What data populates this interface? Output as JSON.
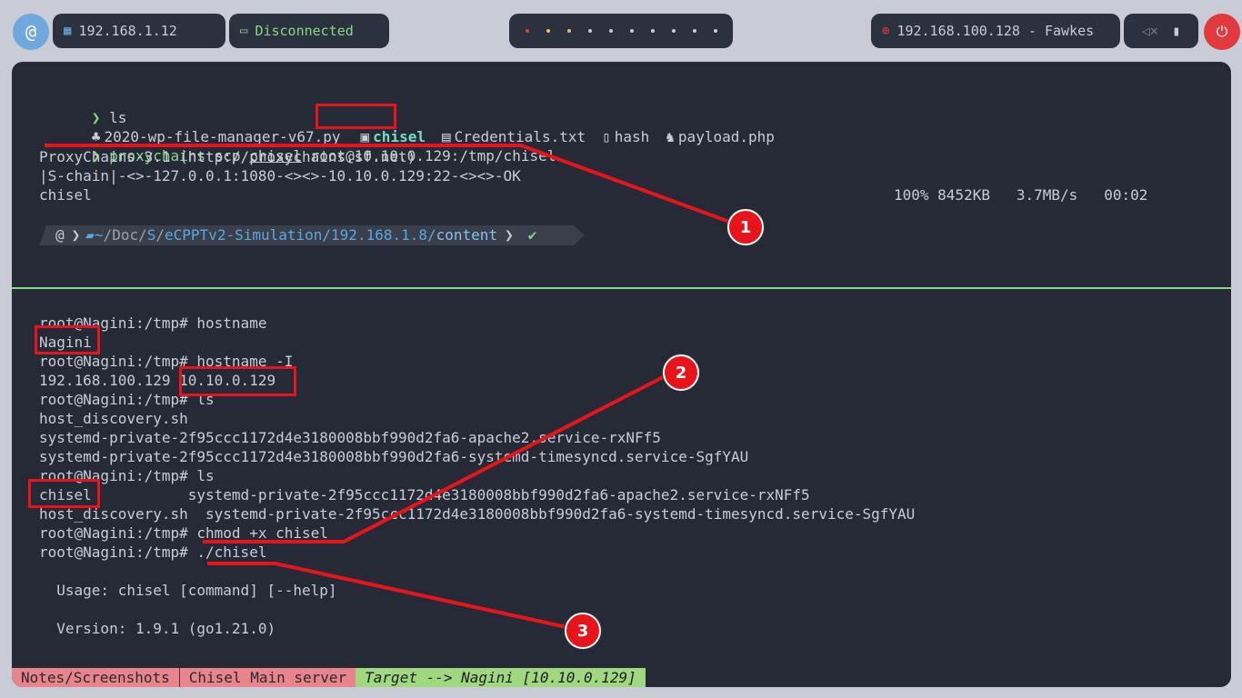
{
  "topbar": {
    "ip_local": "192.168.1.12",
    "vpn_status": "Disconnected",
    "target": "192.168.100.128 - Fawkes"
  },
  "terminal_top": {
    "line1_cmd": "ls",
    "files": [
      "2020-wp-file-manager-v67.py",
      "chisel",
      "Credentials.txt",
      "hash",
      "payload.php"
    ],
    "scp_cmd": "proxychains",
    "scp_rest1": " scp ",
    "scp_file": "chisel",
    "scp_rest2": " root@10.10.0.129:/tmp/chisel",
    "out1": "ProxyChains-3.1 (http://proxychains.sf.net)",
    "out2": "|S-chain|-<>-127.0.0.1:1080-<><>-10.10.0.129:22-<><>-OK",
    "out3_name": "chisel",
    "out3_stats": "100% 8452KB   3.7MB/s   00:02",
    "path_tilde": "~",
    "path_doc": "/Doc/",
    "path_s": "S",
    "path_sep": "/",
    "path_rest": "eCPPTv2-Simulation/192.168.1.8/",
    "path_last": "content"
  },
  "terminal_bottom": {
    "l1": "root@Nagini:/tmp# hostname",
    "l2": "Nagini",
    "l3": "root@Nagini:/tmp# hostname -I",
    "l4a": "192.168.100.129 ",
    "l4b": "10.10.0.129",
    "l5": "root@Nagini:/tmp# ls",
    "l6": "host_discovery.sh",
    "l7": "systemd-private-2f95ccc1172d4e3180008bbf990d2fa6-apache2.service-rxNFf5",
    "l8": "systemd-private-2f95ccc1172d4e3180008bbf990d2fa6-systemd-timesyncd.service-SgfYAU",
    "l9": "root@Nagini:/tmp# ls",
    "l10a": "chisel",
    "l10b": "           systemd-private-2f95ccc1172d4e3180008bbf990d2fa6-apache2.service-rxNFf5",
    "l11": "host_discovery.sh  systemd-private-2f95ccc1172d4e3180008bbf990d2fa6-systemd-timesyncd.service-SgfYAU",
    "l12": "root@Nagini:/tmp# chmod +x chisel",
    "l13": "root@Nagini:/tmp# ./chisel",
    "l14": "  Usage: chisel [command] [--help]",
    "l15": "  Version: 1.9.1 (go1.21.0)"
  },
  "annotations": [
    "1",
    "2",
    "3"
  ],
  "statusbar": {
    "seg1": "Notes/Screenshots",
    "seg2": "Chisel Main server",
    "seg3": "Target --> Nagini [10.10.0.129]"
  }
}
